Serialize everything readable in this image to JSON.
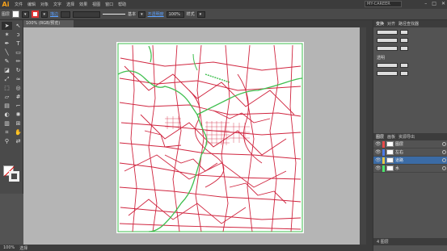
{
  "app": {
    "logo": "Ai",
    "workspace": "MY-CAREER"
  },
  "menus": [
    "文件",
    "编辑",
    "对象",
    "文字",
    "选择",
    "效果",
    "视图",
    "窗口",
    "帮助"
  ],
  "controlbar": {
    "mode": "图层",
    "stroke_label": "描边",
    "stroke_weight_label": "基本",
    "opacity_label": "不透明度",
    "opacity": "100%",
    "style_label": "样式"
  },
  "document": {
    "tab": "100% (RGB/预览)"
  },
  "status": {
    "zoom": "100%",
    "tool": "选择"
  },
  "panel": {
    "tabs": [
      "变换",
      "对齐",
      "路径查找器"
    ],
    "section_label": "透明",
    "layers_tabs": [
      "图层",
      "画板",
      "资源导出"
    ],
    "layers": [
      {
        "name": "图层",
        "color": "#e64a4a"
      },
      {
        "name": "左右",
        "color": "#4a7ae6"
      },
      {
        "name": "道路",
        "color": "#e6c84a"
      },
      {
        "name": "水",
        "color": "#4ae66a"
      }
    ],
    "footer": "4 图层"
  }
}
